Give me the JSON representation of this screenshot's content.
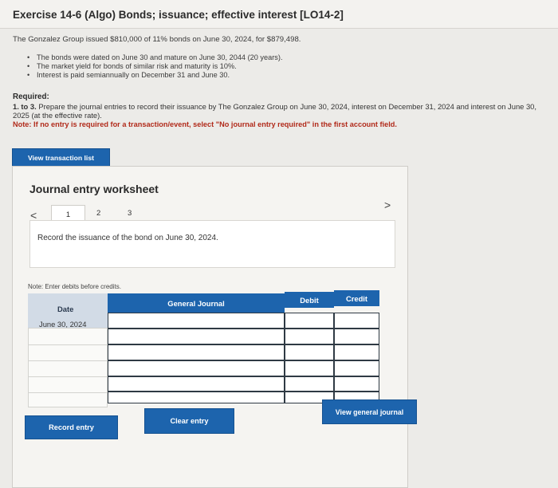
{
  "header": {
    "title": "Exercise 14-6 (Algo) Bonds; issuance; effective interest [LO14-2]"
  },
  "problem": {
    "intro": "The Gonzalez Group issued $810,000 of 11% bonds on June 30, 2024, for $879,498.",
    "bullets": [
      "The bonds were dated on June 30 and mature on June 30, 2044 (20 years).",
      "The market yield for bonds of similar risk and maturity is 10%.",
      "Interest is paid semiannually on December 31 and June 30."
    ]
  },
  "required": {
    "heading": "Required:",
    "label": "1. to 3.",
    "text": "Prepare the journal entries to record their issuance by The Gonzalez Group on June 30, 2024, interest on December 31, 2024 and interest on June 30, 2025 (at the effective rate).",
    "note": "Note: If no entry is required for a transaction/event, select \"No journal entry required\" in the first account field."
  },
  "buttons": {
    "view_transaction_list": "View transaction list",
    "record_entry": "Record entry",
    "clear_entry": "Clear entry",
    "view_general_journal": "View general journal"
  },
  "worksheet": {
    "title": "Journal entry worksheet",
    "prev": "<",
    "next": ">",
    "tabs": [
      "1",
      "2",
      "3"
    ],
    "record_prompt": "Record the issuance of the bond on June 30, 2024.",
    "note": "Note: Enter debits before credits.",
    "columns": {
      "date": "Date",
      "general_journal": "General Journal",
      "debit": "Debit",
      "credit": "Credit"
    },
    "rows": [
      {
        "date": "June 30, 2024"
      }
    ]
  },
  "colors": {
    "accent": "#1d64ad",
    "note_red": "#b12a1a"
  }
}
